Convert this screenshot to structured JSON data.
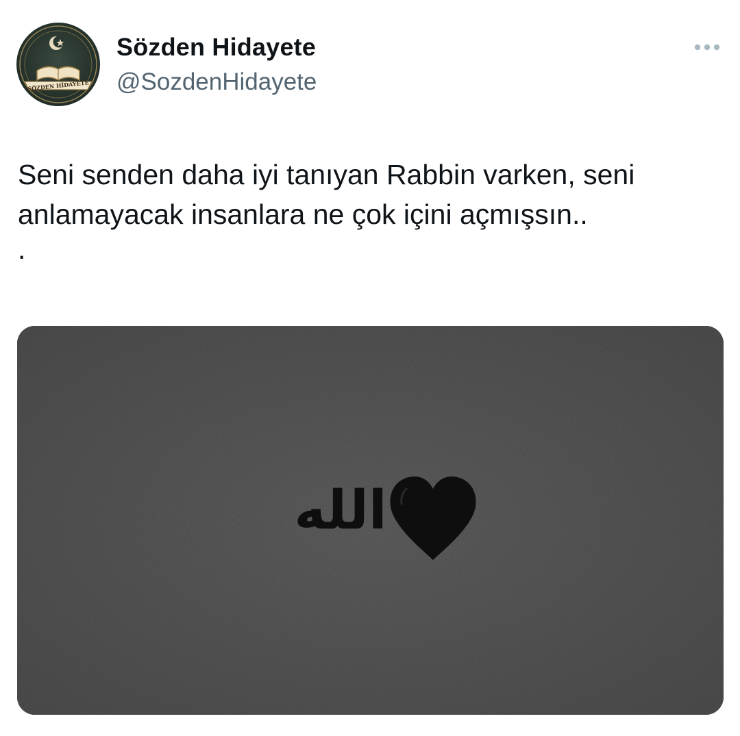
{
  "tweet": {
    "author": {
      "display_name": "Sözden Hidayete",
      "handle": "@SozdenHidayete",
      "avatar_label": "SÖZDEN HİDAYETE"
    },
    "more_icon": "more-horizontal-icon",
    "text_lines": [
      "Seni senden daha iyi tanıyan Rabbin varken, seni",
      "anlamayacak insanlara ne çok içini açmışsın..",
      "."
    ],
    "media": {
      "calligraphy": "الله",
      "heart_icon": "black-heart-icon",
      "background_color": "#4a4a4a",
      "ink_color": "#0e0e0e"
    }
  },
  "colors": {
    "text": "#0f1419",
    "secondary": "#536471"
  }
}
